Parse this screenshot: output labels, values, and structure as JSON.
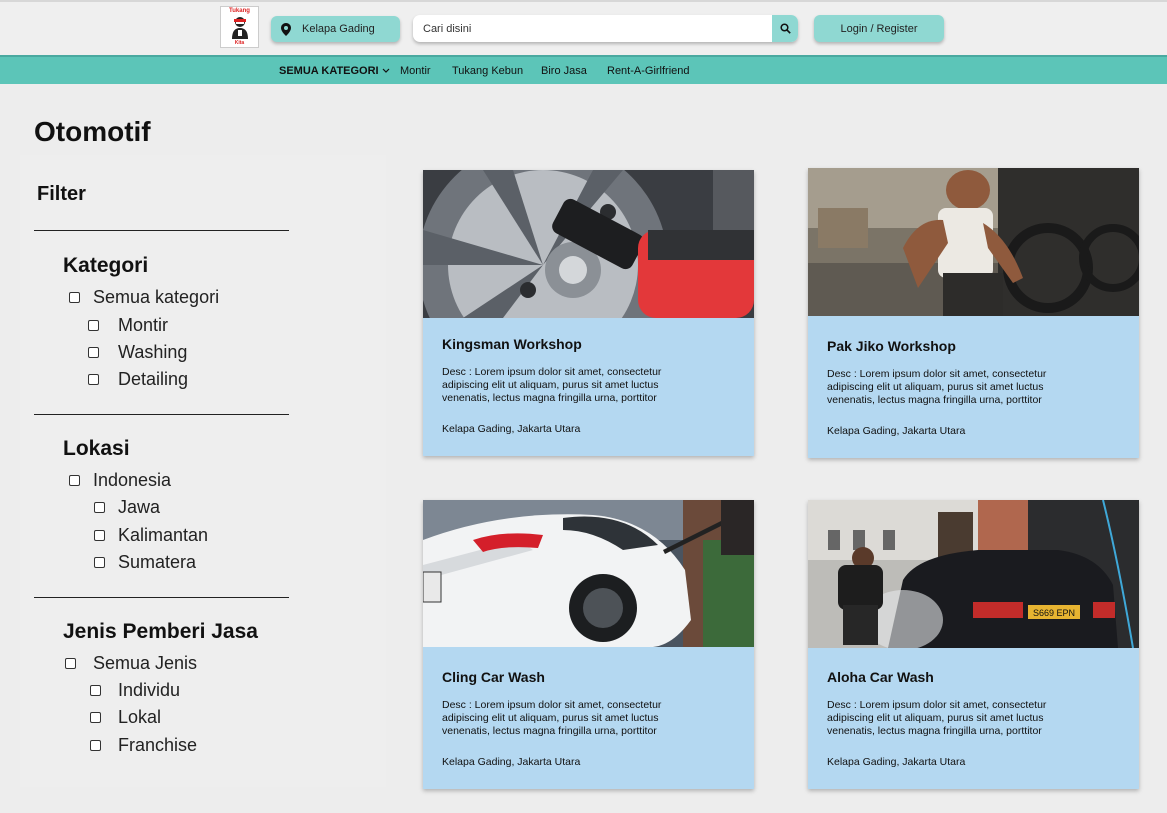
{
  "brand": {
    "logo_top": "Tukang",
    "logo_bottom": "Kita"
  },
  "header": {
    "location_label": "Kelapa Gading",
    "search_placeholder": "Cari disini",
    "login_label": "Login / Register"
  },
  "nav": {
    "all_categories": "SEMUA KATEGORI",
    "items": [
      "Montir",
      "Tukang Kebun",
      "Biro Jasa",
      "Rent-A-Girlfriend"
    ]
  },
  "page": {
    "title": "Otomotif"
  },
  "filter": {
    "title": "Filter",
    "groups": [
      {
        "title": "Kategori",
        "parent": "Semua kategori",
        "options": [
          "Montir",
          "Washing",
          "Detailing"
        ]
      },
      {
        "title": "Lokasi",
        "parent": "Indonesia",
        "options": [
          "Jawa",
          "Kalimantan",
          "Sumatera"
        ]
      },
      {
        "title": "Jenis Pemberi Jasa",
        "parent": "Semua Jenis",
        "options": [
          "Individu",
          "Lokal",
          "Franchise"
        ]
      }
    ]
  },
  "cards": [
    {
      "title": "Kingsman Workshop",
      "desc": "Desc : Lorem ipsum dolor sit amet, consectetur adipiscing elit ut aliquam, purus sit amet luctus venenatis, lectus magna fringilla urna, porttitor",
      "location": "Kelapa Gading, Jakarta Utara"
    },
    {
      "title": "Pak Jiko Workshop",
      "desc": "Desc : Lorem ipsum dolor sit amet, consectetur adipiscing elit ut aliquam, purus sit amet luctus venenatis, lectus magna fringilla urna, porttitor",
      "location": "Kelapa Gading, Jakarta Utara"
    },
    {
      "title": "Cling Car Wash",
      "desc": "Desc : Lorem ipsum dolor sit amet, consectetur adipiscing elit ut aliquam, purus sit amet luctus venenatis, lectus magna fringilla urna, porttitor",
      "location": "Kelapa Gading, Jakarta Utara"
    },
    {
      "title": "Aloha Car Wash",
      "desc": "Desc : Lorem ipsum dolor sit amet, consectetur adipiscing elit ut aliquam, purus sit amet luctus venenatis, lectus magna fringilla urna, porttitor",
      "location": "Kelapa Gading, Jakarta Utara"
    }
  ],
  "plate_text": "S669 EPN",
  "colors": {
    "accent": "#5cc5b8",
    "button": "#8fd8d2",
    "card": "#b4d8f1",
    "background": "#ededed"
  },
  "icons": {
    "location": "map-pin-icon",
    "search": "search-icon",
    "dropdown": "chevron-down-icon"
  }
}
